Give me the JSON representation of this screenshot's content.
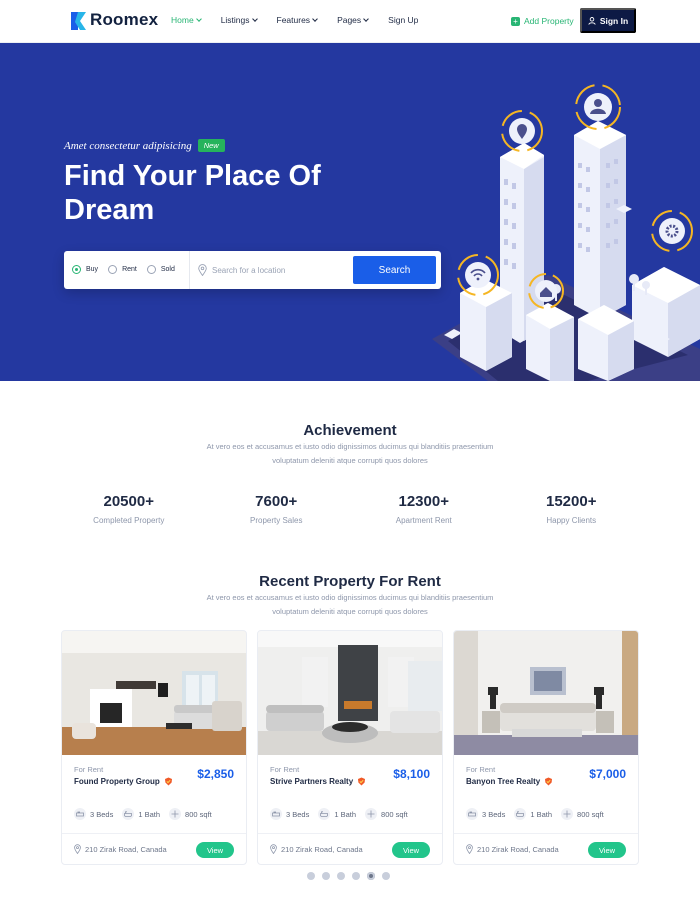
{
  "brand": {
    "name": "Roomex",
    "accent": "#28b574",
    "primary": "#1a5ee8",
    "hero_bg": "#2438a0",
    "dark": "#0d1a45"
  },
  "nav": {
    "items": [
      {
        "label": "Home",
        "dropdown": true,
        "active": true
      },
      {
        "label": "Listings",
        "dropdown": true
      },
      {
        "label": "Features",
        "dropdown": true
      },
      {
        "label": "Pages",
        "dropdown": true
      },
      {
        "label": "Sign Up",
        "dropdown": false
      }
    ],
    "add_property": "Add Property",
    "sign_in": "Sign In"
  },
  "hero": {
    "subtitle": "Amet consectetur adipisicing",
    "badge": "New",
    "title": "Find Your Place Of Dream",
    "search": {
      "options": [
        "Buy",
        "Rent",
        "Sold"
      ],
      "selected": "Buy",
      "placeholder": "Search for a location",
      "value": "",
      "button": "Search"
    }
  },
  "achievement": {
    "title": "Achievement",
    "description": "At vero eos et accusamus et iusto odio dignissimos ducimus qui blanditiis praesentium voluptatum deleniti atque corrupti quos dolores",
    "stats": [
      {
        "value": "20500+",
        "label": "Completed Property"
      },
      {
        "value": "7600+",
        "label": "Property Sales"
      },
      {
        "value": "12300+",
        "label": "Apartment Rent"
      },
      {
        "value": "15200+",
        "label": "Happy Clients"
      }
    ]
  },
  "recent": {
    "title": "Recent Property For Rent",
    "description": "At vero eos et accusamus et iusto odio dignissimos ducimus qui blanditiis praesentium voluptatum deleniti atque corrupti quos dolores",
    "cards": [
      {
        "type": "For Rent",
        "name": "Found Property Group",
        "price": "$2,850",
        "beds": "3 Beds",
        "bath": "1 Bath",
        "area": "800 sqft",
        "address": "210 Zirak Road, Canada",
        "view": "View"
      },
      {
        "type": "For Rent",
        "name": "Strive Partners Realty",
        "price": "$8,100",
        "beds": "3 Beds",
        "bath": "1 Bath",
        "area": "800 sqft",
        "address": "210 Zirak Road, Canada",
        "view": "View"
      },
      {
        "type": "For Rent",
        "name": "Banyon Tree Realty",
        "price": "$7,000",
        "beds": "3 Beds",
        "bath": "1 Bath",
        "area": "800 sqft",
        "address": "210 Zirak Road, Canada",
        "view": "View"
      }
    ],
    "pagination": {
      "count": 6,
      "active_index": 4
    }
  }
}
